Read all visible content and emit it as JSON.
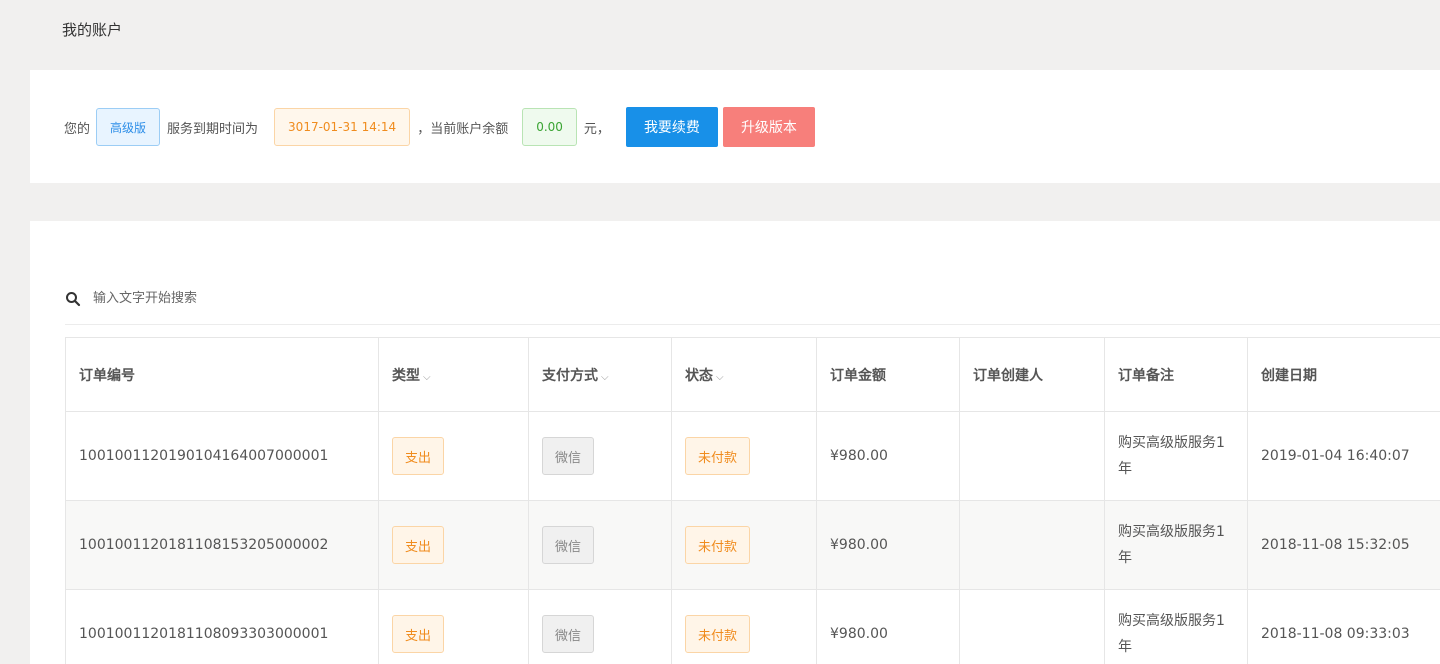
{
  "page": {
    "title": "我的账户"
  },
  "account": {
    "prefix": "您的",
    "plan": "高级版",
    "service_text": "服务到期时间为",
    "expire": "3017-01-31 14:14",
    "balance_text": "，当前账户余额",
    "balance": "0.00",
    "unit": "元，",
    "renew_label": "我要续费",
    "upgrade_label": "升级版本"
  },
  "search": {
    "placeholder": "输入文字开始搜索",
    "value": ""
  },
  "table": {
    "headers": [
      "订单编号",
      "类型",
      "支付方式",
      "状态",
      "订单金额",
      "订单创建人",
      "订单备注",
      "创建日期"
    ],
    "rows": [
      {
        "id": "1001001120190104164007000001",
        "type": "支出",
        "pay": "微信",
        "status": "未付款",
        "amount": "¥980.00",
        "creator": "",
        "note": "购买高级版服务1年",
        "date": "2019-01-04 16:40:07"
      },
      {
        "id": "1001001120181108153205000002",
        "type": "支出",
        "pay": "微信",
        "status": "未付款",
        "amount": "¥980.00",
        "creator": "",
        "note": "购买高级版服务1年",
        "date": "2018-11-08 15:32:05"
      },
      {
        "id": "1001001120181108093303000001",
        "type": "支出",
        "pay": "微信",
        "status": "未付款",
        "amount": "¥980.00",
        "creator": "",
        "note": "购买高级版服务1年",
        "date": "2018-11-08 09:33:03"
      }
    ]
  },
  "icons": {
    "search": "search-icon",
    "sort": "chevron-down-icon"
  },
  "colors": {
    "primary": "#1890e8",
    "danger": "#f77f7b",
    "warning": "#f08c1e",
    "success": "#3aa433",
    "info": "#2d8ee8"
  }
}
